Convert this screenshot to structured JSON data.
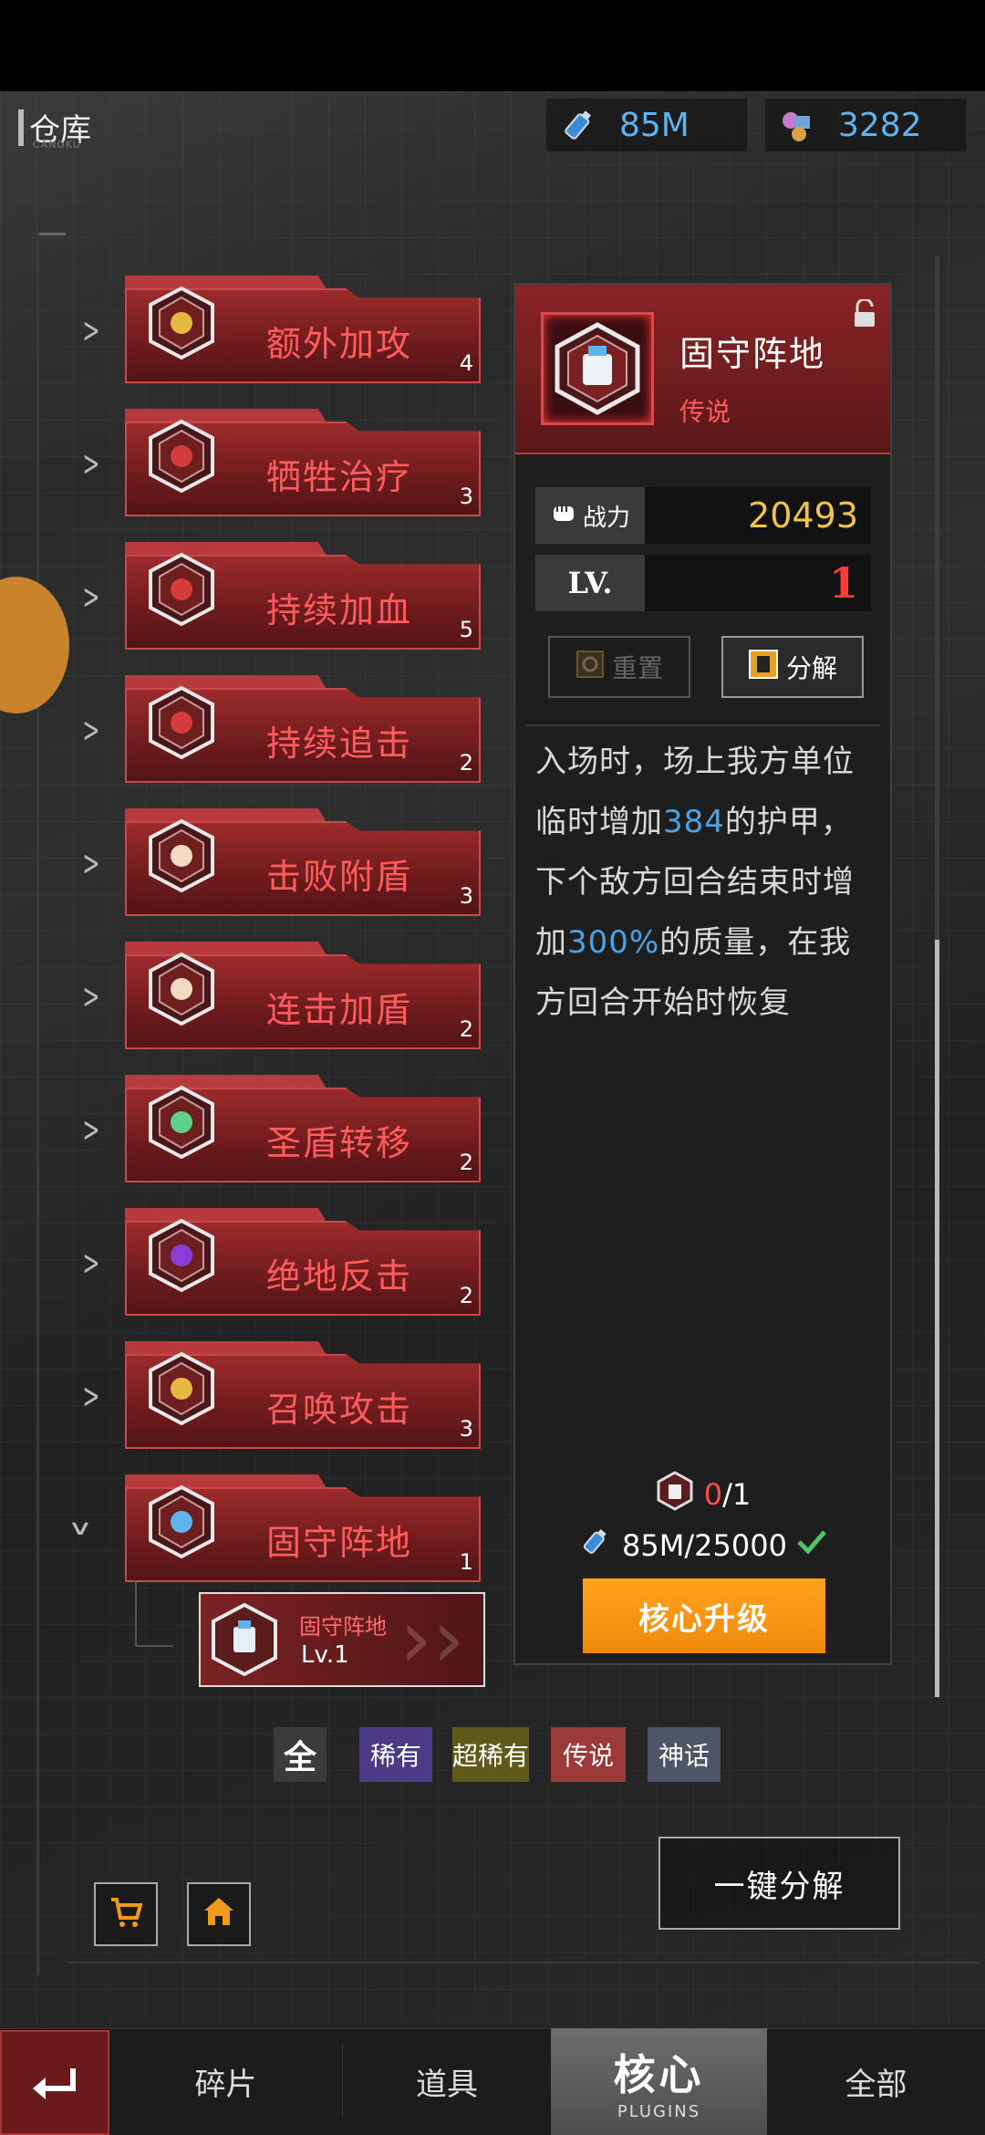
{
  "header": {
    "title": "仓库",
    "subtitle": "CANGKU"
  },
  "resources": {
    "energy": "85M",
    "parts": "3282"
  },
  "plugins": [
    {
      "name": "额外加攻",
      "count": "4",
      "color": "#e6b940"
    },
    {
      "name": "牺牲治疗",
      "count": "3",
      "color": "#d43b3b"
    },
    {
      "name": "持续加血",
      "count": "5",
      "color": "#d43b3b"
    },
    {
      "name": "持续追击",
      "count": "2",
      "color": "#d43b3b"
    },
    {
      "name": "击败附盾",
      "count": "3",
      "color": "#f2d9c0"
    },
    {
      "name": "连击加盾",
      "count": "2",
      "color": "#f2d9c0"
    },
    {
      "name": "圣盾转移",
      "count": "2",
      "color": "#5fd08a"
    },
    {
      "name": "绝地反击",
      "count": "2",
      "color": "#8a3dd6"
    },
    {
      "name": "召唤攻击",
      "count": "3",
      "color": "#e6b940"
    },
    {
      "name": "固守阵地",
      "count": "1",
      "color": "#5fb4ef"
    }
  ],
  "expanded": {
    "name": "固守阵地",
    "level": "Lv.1"
  },
  "detail": {
    "title": "固守阵地",
    "rarity": "传说",
    "power_label": "战力",
    "power_value": "20493",
    "lv_label": "LV.",
    "lv_value": "1",
    "reset_label": "重置",
    "dismantle_label": "分解",
    "desc_1": "入场时，场上我方单位临时增加",
    "desc_hl1": "384",
    "desc_2": "的护甲，下个敌方回合结束时增加",
    "desc_hl2": "300%",
    "desc_3": "的质量，在我方回合开始时恢复",
    "shard_have": "0",
    "shard_need": "/1",
    "energy_cost": "85M/25000",
    "upgrade_label": "核心升级"
  },
  "filters": [
    {
      "label": "全",
      "bg": "#3b3b3b"
    },
    {
      "label": "稀有",
      "bg": "#4b3a86"
    },
    {
      "label": "超稀有",
      "bg": "#5f5a1a"
    },
    {
      "label": "传说",
      "bg": "#9c3a3a"
    },
    {
      "label": "神话",
      "bg": "#4d5566"
    }
  ],
  "one_click_label": "一键分解",
  "tabs": {
    "fragments": "碎片",
    "items": "道具",
    "core": "核心",
    "core_sub": "PLUGINS",
    "all": "全部"
  }
}
